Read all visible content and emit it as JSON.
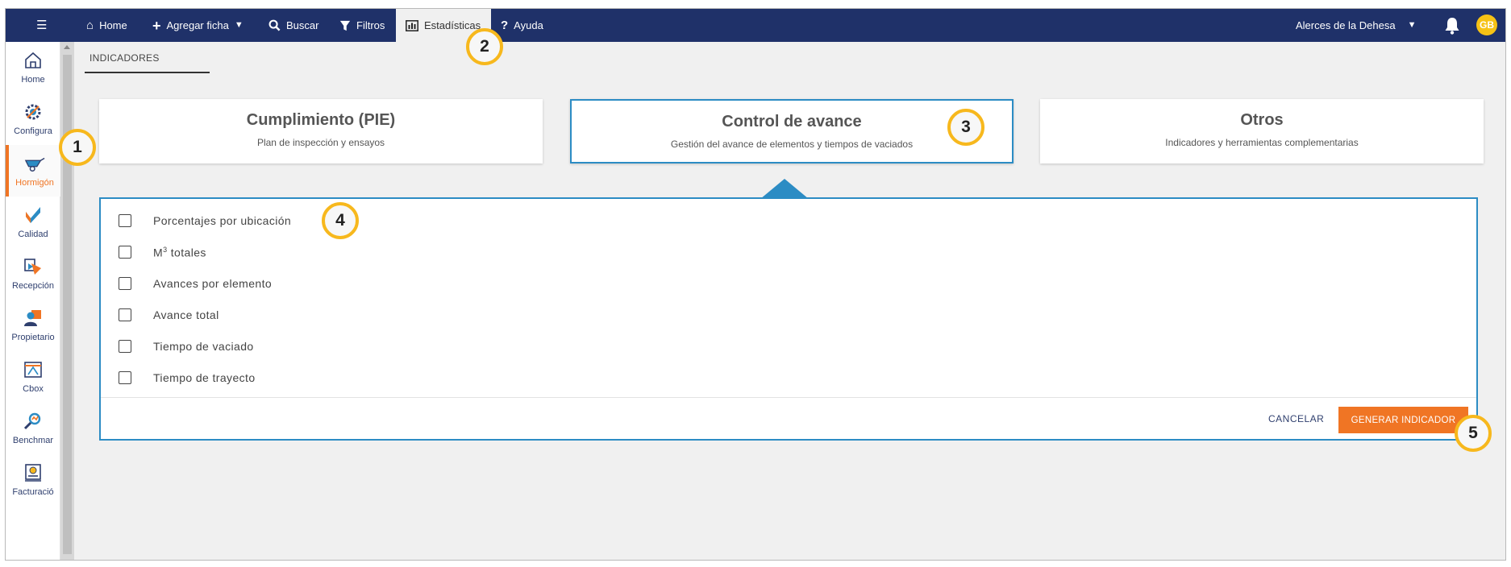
{
  "nav": {
    "menu_icon": "hamburger-icon",
    "home": "Home",
    "add": "Agregar ficha",
    "search": "Buscar",
    "filters": "Filtros",
    "stats": "Estadísticas",
    "help": "Ayuda",
    "project": "Alerces de la Dehesa",
    "avatar_initials": "GB"
  },
  "sidebar": {
    "items": [
      {
        "label": "Home",
        "icon": "home-icon"
      },
      {
        "label": "Configura",
        "icon": "gear-icon"
      },
      {
        "label": "Hormigón",
        "icon": "wheelbarrow-icon",
        "active": true
      },
      {
        "label": "Calidad",
        "icon": "quality-icon"
      },
      {
        "label": "Recepción",
        "icon": "reception-icon"
      },
      {
        "label": "Propietario",
        "icon": "owner-icon"
      },
      {
        "label": "Cbox",
        "icon": "cbox-icon"
      },
      {
        "label": "Benchmar",
        "icon": "benchmark-icon"
      },
      {
        "label": "Facturació",
        "icon": "billing-icon"
      }
    ]
  },
  "tab": {
    "label": "INDICADORES"
  },
  "cards": [
    {
      "title": "Cumplimiento (PIE)",
      "subtitle": "Plan de inspección y ensayos"
    },
    {
      "title": "Control de avance",
      "subtitle": "Gestión del avance de elementos y tiempos de vaciados",
      "selected": true
    },
    {
      "title": "Otros",
      "subtitle": "Indicadores y herramientas complementarias"
    }
  ],
  "options": [
    {
      "label": "Porcentajes por ubicación",
      "checked": false
    },
    {
      "label_prefix": "M",
      "label_sup": "3",
      "label_suffix": " totales",
      "checked": false
    },
    {
      "label": "Avances por elemento",
      "checked": false
    },
    {
      "label": "Avance total",
      "checked": false
    },
    {
      "label": "Tiempo de vaciado",
      "checked": false
    },
    {
      "label": "Tiempo de trayecto",
      "checked": false
    }
  ],
  "actions": {
    "cancel": "CANCELAR",
    "generate": "GENERAR INDICADOR"
  },
  "callouts": [
    "1",
    "2",
    "3",
    "4",
    "5"
  ],
  "colors": {
    "navbar": "#1f3169",
    "accent": "#f07524",
    "selected_border": "#2c8cc4",
    "callout_ring": "#f7b81d"
  }
}
